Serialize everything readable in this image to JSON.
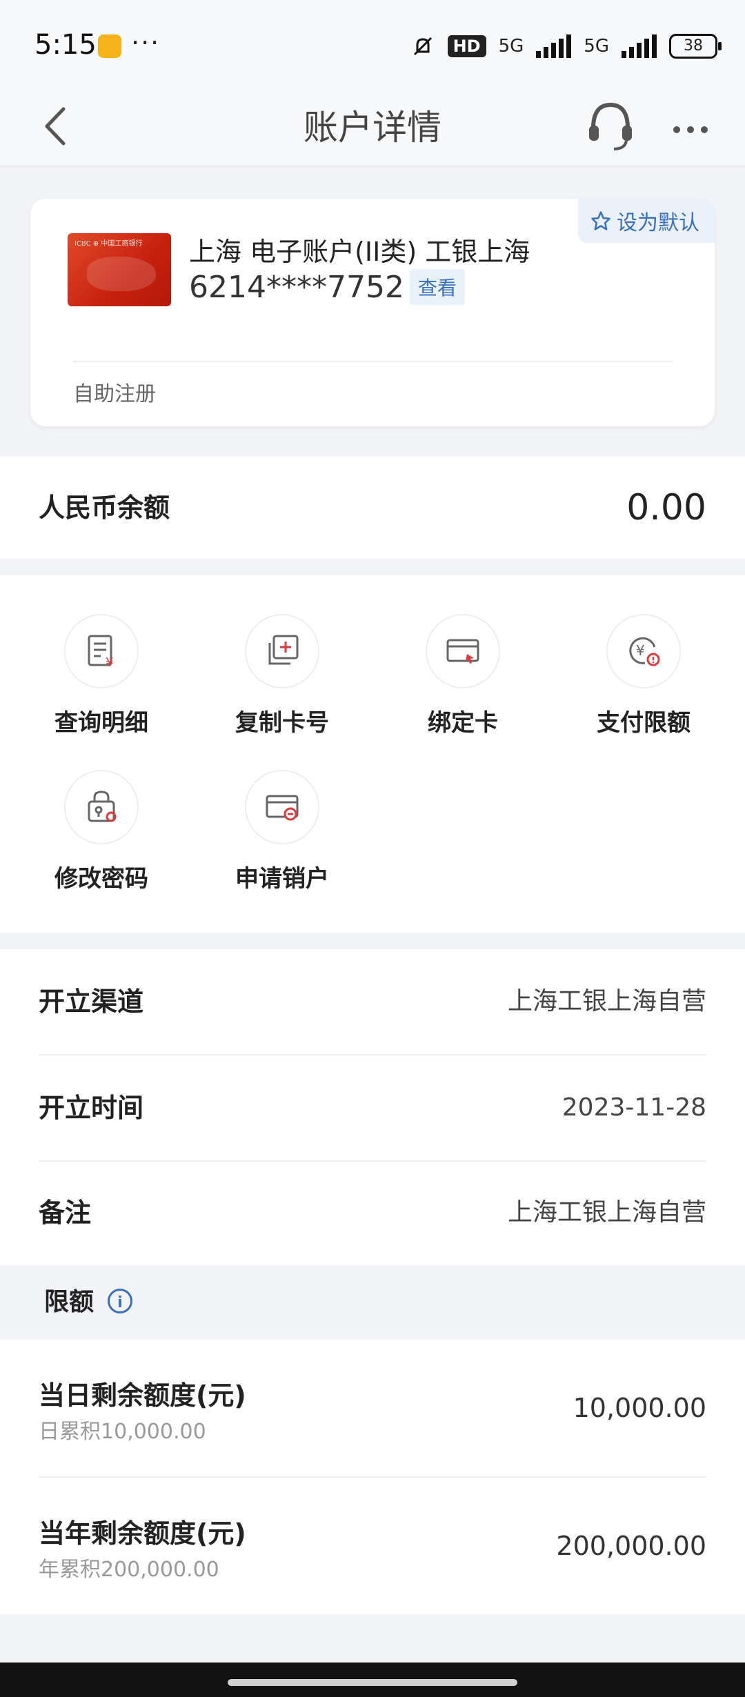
{
  "status": {
    "time": "5:15",
    "hd": "HD",
    "network_1": "5G",
    "network_2": "5G",
    "battery": "38"
  },
  "nav": {
    "title": "账户详情"
  },
  "card": {
    "default_label": "设为默认",
    "account_name": "上海 电子账户(II类) 工银上海",
    "account_number": "6214****7752",
    "view_label": "查看",
    "footer": "自助注册"
  },
  "balance": {
    "label": "人民币余额",
    "value": "0.00"
  },
  "functions": [
    {
      "label": "查询明细",
      "icon": "statement-icon"
    },
    {
      "label": "复制卡号",
      "icon": "copy-card-icon"
    },
    {
      "label": "绑定卡",
      "icon": "bind-card-icon"
    },
    {
      "label": "支付限额",
      "icon": "payment-limit-icon"
    },
    {
      "label": "修改密码",
      "icon": "password-icon"
    },
    {
      "label": "申请销户",
      "icon": "close-account-icon"
    }
  ],
  "info": [
    {
      "key": "开立渠道",
      "value": "上海工银上海自营"
    },
    {
      "key": "开立时间",
      "value": "2023-11-28"
    },
    {
      "key": "备注",
      "value": "上海工银上海自营"
    }
  ],
  "limits": {
    "title": "限额",
    "rows": [
      {
        "key": "当日剩余额度(元)",
        "sub": "日累积10,000.00",
        "value": "10,000.00"
      },
      {
        "key": "当年剩余额度(元)",
        "sub": "年累积200,000.00",
        "value": "200,000.00"
      }
    ]
  },
  "colors": {
    "accent": "#3a6fc0",
    "card_red": "#d2331a",
    "icon_red": "#e0393e"
  }
}
